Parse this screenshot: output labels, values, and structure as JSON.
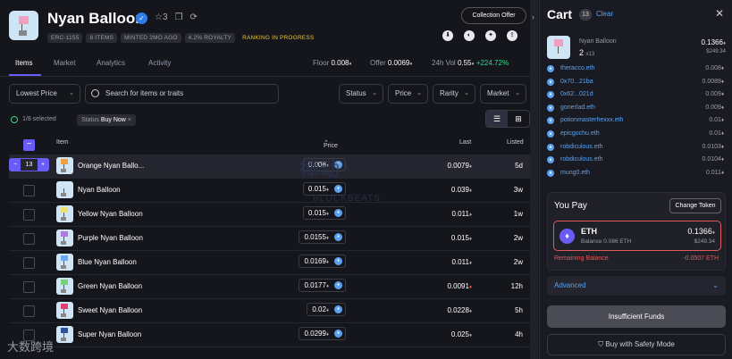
{
  "collection": {
    "title": "Nyan Balloon",
    "favorites": "3",
    "tags": [
      "ERC-1155",
      "8 ITEMS",
      "MINTED 2MO AGO",
      "4.2% ROYALTY"
    ],
    "status_tag": "RANKING IN PROGRESS",
    "offer_button": "Collection Offer"
  },
  "tabs": [
    "Items",
    "Market",
    "Analytics",
    "Activity"
  ],
  "stats": {
    "floor_label": "Floor",
    "floor_value": "0.008",
    "offer_label": "Offer",
    "offer_value": "0.0069",
    "vol_label": "24h Vol",
    "vol_value": "0.55",
    "vol_change": "+224.72%"
  },
  "controls": {
    "sort": "Lowest Price",
    "search_placeholder": "Search for items or traits",
    "status": "Status",
    "price": "Price",
    "rarity": "Rarity",
    "market": "Market"
  },
  "filter": {
    "selected": "1/8 selected",
    "chip_label": "Status",
    "chip_value": "Buy Now",
    "chip_close": "×"
  },
  "table": {
    "headers": {
      "item": "Item",
      "price": "Price",
      "last": "Last",
      "listed": "Listed"
    },
    "rows": [
      {
        "name": "Orange Nyan Ballo...",
        "price": "0.008",
        "last": "0.0079",
        "listed": "5d",
        "color": "#f0a040"
      },
      {
        "name": "Nyan Balloon",
        "price": "0.015",
        "last": "0.039",
        "listed": "3w",
        "color": "#cfe4f5"
      },
      {
        "name": "Yellow Nyan Balloon",
        "price": "0.015",
        "last": "0.011",
        "listed": "1w",
        "color": "#f0e070"
      },
      {
        "name": "Purple Nyan Balloon",
        "price": "0.0155",
        "last": "0.015",
        "listed": "2w",
        "color": "#b07ae0"
      },
      {
        "name": "Blue Nyan Balloon",
        "price": "0.0169",
        "last": "0.011",
        "listed": "2w",
        "color": "#6aaaf0"
      },
      {
        "name": "Green Nyan Balloon",
        "price": "0.0177",
        "last": "0.0091",
        "listed": "12h",
        "color": "#7ad07a"
      },
      {
        "name": "Sweet Nyan Balloon",
        "price": "0.02",
        "last": "0.0228",
        "listed": "5h",
        "color": "#e04070"
      },
      {
        "name": "Super Nyan Balloon",
        "price": "0.0299",
        "last": "0.025",
        "listed": "4h",
        "color": "#3050a0"
      }
    ],
    "stepper": {
      "minus": "−",
      "qty": "13",
      "plus": "+"
    }
  },
  "watermark": {
    "line1": "律动",
    "line2": "BLOCKBEATS",
    "corner": "大数跨境"
  },
  "cart": {
    "title": "Cart",
    "count": "13",
    "clear": "Clear",
    "item": {
      "name": "Nyan Balloon",
      "qty": "2",
      "qty_sub": "x13",
      "price": "0.1366",
      "usd": "$249.34"
    },
    "sellers": [
      {
        "name": "theracco.eth",
        "price": "0.008"
      },
      {
        "name": "0x70...21ba",
        "price": "0.0089"
      },
      {
        "name": "0x62...021d",
        "price": "0.009"
      },
      {
        "name": "gonerlad.eth",
        "price": "0.009"
      },
      {
        "name": "potionmasterhexxx.eth",
        "price": "0.01"
      },
      {
        "name": "epicgochu.eth",
        "price": "0.01"
      },
      {
        "name": "robdiculous.eth",
        "price": "0.0103"
      },
      {
        "name": "robdiculous.eth",
        "price": "0.0104"
      },
      {
        "name": "mung0.eth",
        "price": "0.011"
      }
    ],
    "you_pay": "You Pay",
    "change_token": "Change Token",
    "token": {
      "symbol": "ETH",
      "balance": "Balance 0.086 ETH",
      "amount": "0.1366",
      "usd": "$249.34"
    },
    "remaining_label": "Remaining Balance",
    "remaining_value": "-0.0507 ETH",
    "advanced": "Advanced",
    "insufficient": "Insufficient Funds",
    "safety": "Buy with Safety Mode"
  }
}
